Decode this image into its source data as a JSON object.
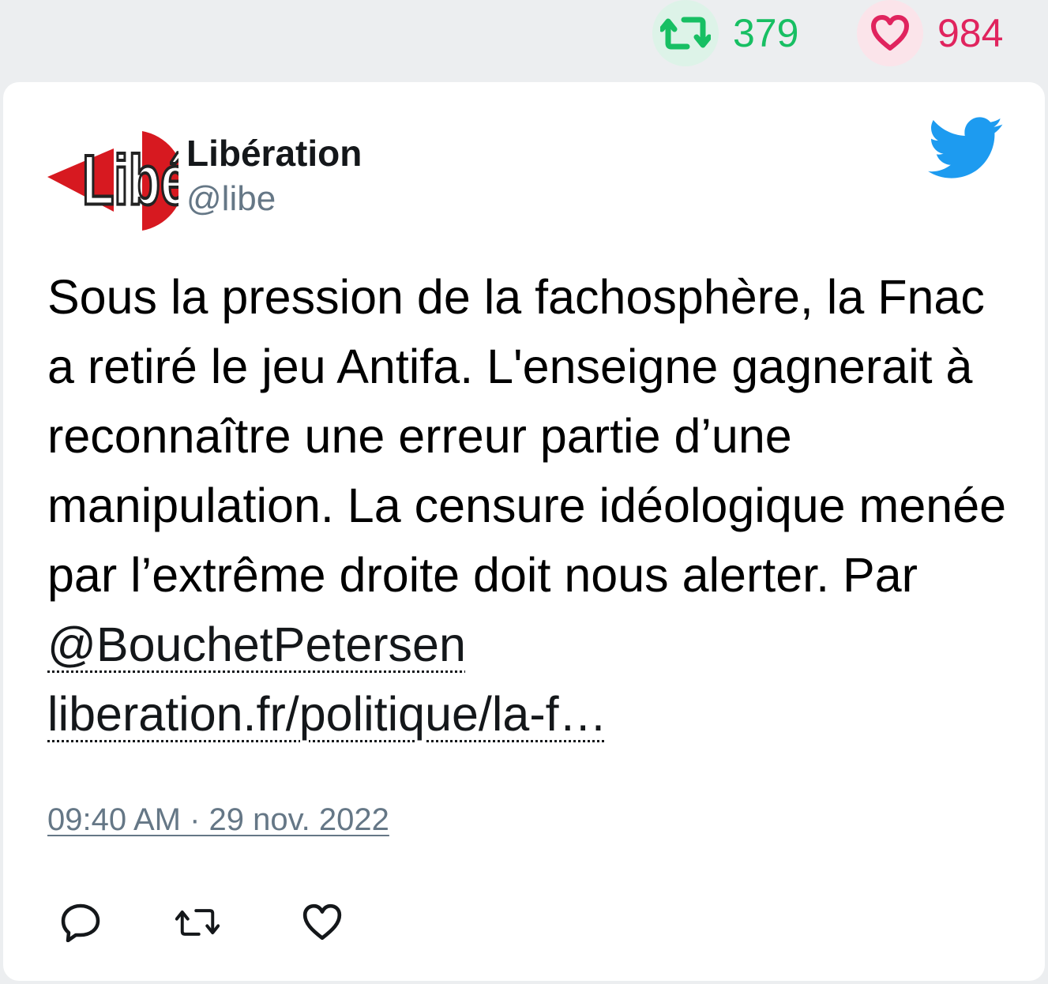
{
  "stats": {
    "retweet_icon": "retweet-icon",
    "retweet_count": "379",
    "like_icon": "heart-icon",
    "like_count": "984",
    "retweet_color": "#17bf63",
    "like_color": "#e0245e"
  },
  "tweet": {
    "author": {
      "display_name": "Libération",
      "handle": "@libe",
      "avatar_logo_text": "Libé"
    },
    "platform_icon": "twitter-bird-icon",
    "text_main": "Sous la pression de la fachosphère, la Fnac a retiré le jeu Antifa. L'enseigne gagnerait à reconnaître une erreur partie d’une manipulation. La censure idéologique menée par l’extrême droite doit nous alerter. Par ",
    "mention": "@BouchetPetersen",
    "link": "liberation.fr/politique/la-f…",
    "timestamp": "09:40 AM · 29 nov. 2022"
  },
  "actions": {
    "reply_icon": "reply-icon",
    "retweet_icon": "retweet-icon",
    "like_icon": "heart-icon"
  },
  "colors": {
    "twitter_blue": "#1d9bf0",
    "logo_red": "#d71920"
  }
}
